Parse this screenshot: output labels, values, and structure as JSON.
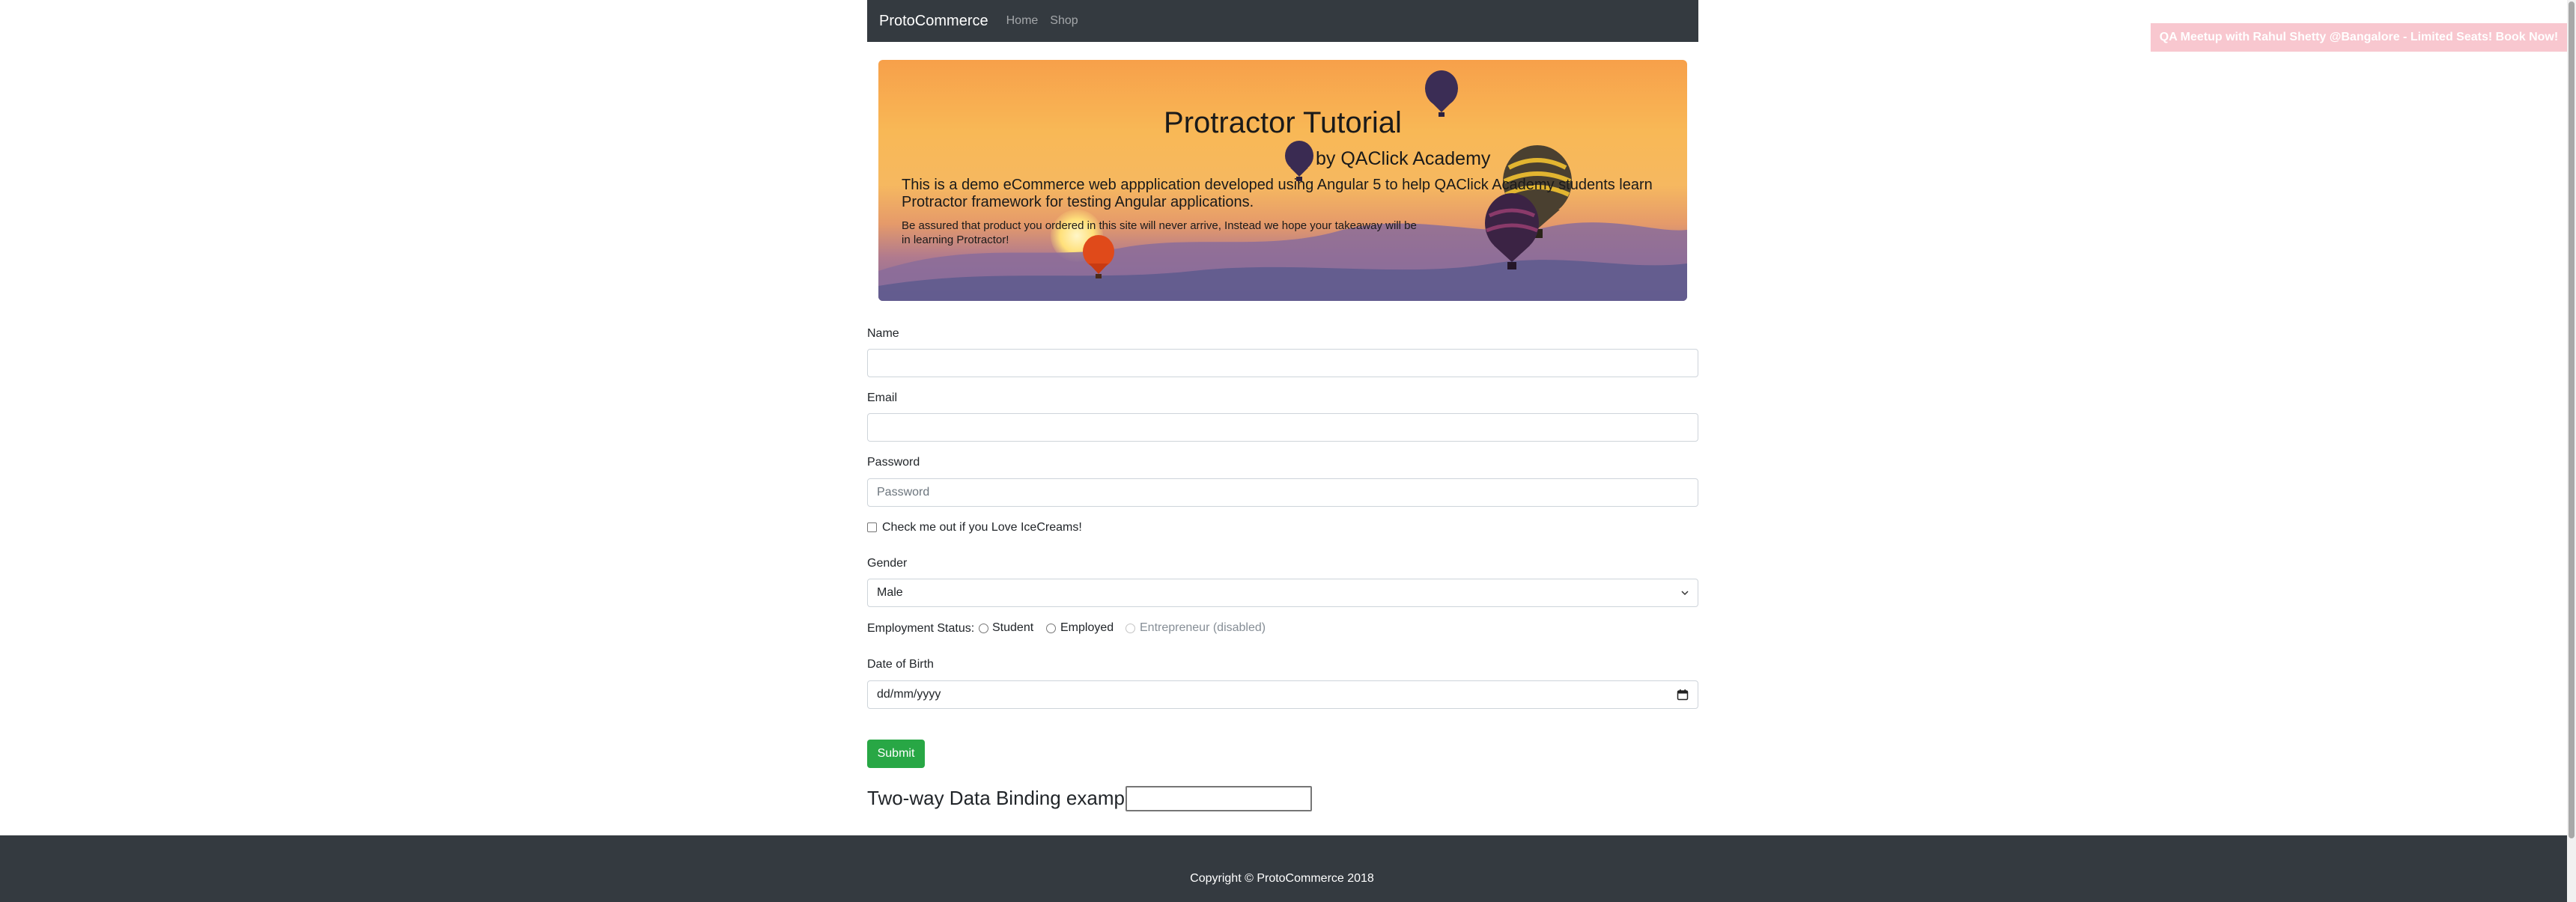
{
  "navbar": {
    "brand": "ProtoCommerce",
    "links": [
      "Home",
      "Shop"
    ]
  },
  "promo": {
    "text": "QA Meetup with Rahul Shetty @Bangalore - Limited Seats! Book Now!",
    "background": "#f8c7cf"
  },
  "hero": {
    "title": "Protractor Tutorial",
    "subtitle": "by QAClick Academy",
    "description": "This is a demo eCommerce web appplication developed using Angular 5 to help QAClick Academy students learn Protractor framework for testing Angular applications.",
    "note": "Be assured that product you ordered in this site will never arrive, Instead we hope your takeaway will be in learning Protractor!"
  },
  "form": {
    "name_label": "Name",
    "name_value": "",
    "email_label": "Email",
    "email_value": "",
    "password_label": "Password",
    "password_placeholder": "Password",
    "checkbox_label": "Check me out if you Love IceCreams!",
    "gender_label": "Gender",
    "gender_selected": "Male",
    "employment_label": "Employment Status:",
    "employment_options": [
      "Student",
      "Employed",
      "Entrepreneur (disabled)"
    ],
    "dob_label": "Date of Birth",
    "dob_placeholder": "dd/mm/yyyy",
    "submit_label": "Submit"
  },
  "binding": {
    "label": "Two-way Data Binding example:",
    "value": ""
  },
  "footer": {
    "text": "Copyright © ProtoCommerce 2018"
  },
  "colors": {
    "navbar": "#343a40",
    "submit": "#28a745",
    "footer": "#343a40"
  }
}
